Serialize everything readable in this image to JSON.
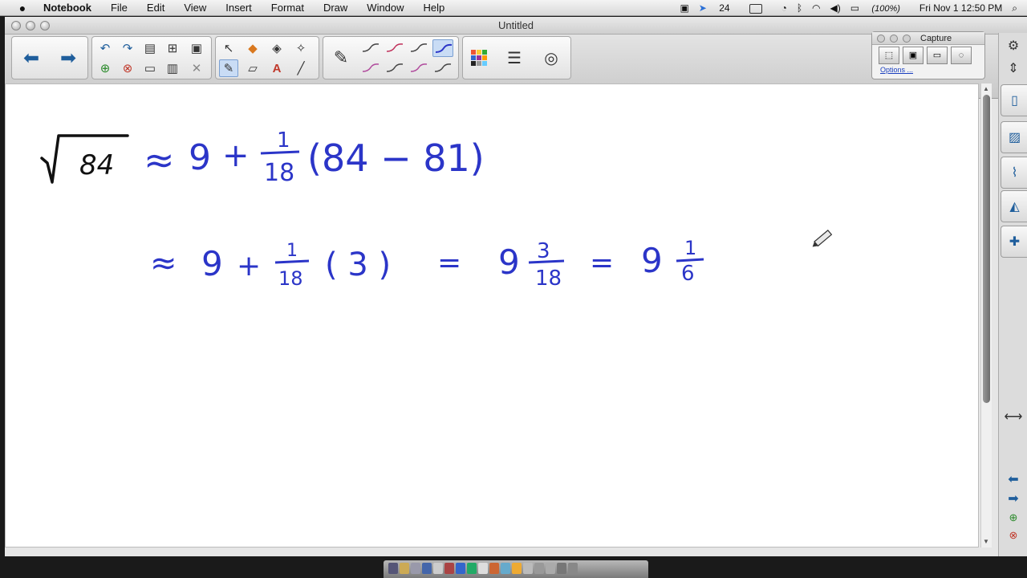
{
  "menubar": {
    "apple": "",
    "app_name": "Notebook",
    "menus": [
      "File",
      "Edit",
      "View",
      "Insert",
      "Format",
      "Draw",
      "Window",
      "Help"
    ],
    "status": {
      "count": "24",
      "battery": "(100%)",
      "datetime": "Fri Nov 1  12:50 PM"
    }
  },
  "window": {
    "title": "Untitled"
  },
  "capture": {
    "title": "Capture",
    "options_link": "Options ..."
  },
  "toolbar": {
    "icons": [
      "back-arrow",
      "forward-arrow",
      "undo",
      "redo",
      "screen-shade",
      "table",
      "delete",
      "select",
      "pens",
      "eraser",
      "text",
      "line",
      "magic-pen",
      "colors",
      "line-properties",
      "fill"
    ]
  },
  "math": {
    "line1": {
      "radicand": "84",
      "approx": "≈",
      "whole": "9",
      "plus": "+",
      "frac_num": "1",
      "frac_den": "18",
      "paren_expr": "(84 − 81)"
    },
    "line2": {
      "approx": "≈",
      "whole": "9",
      "plus": "+",
      "frac_num": "1",
      "frac_den": "18",
      "paren_expr": "( 3 )",
      "eq1": "=",
      "mixed_whole": "9",
      "mixed_num": "3",
      "mixed_den": "18",
      "eq2": "=",
      "result_whole": "9",
      "result_num": "1",
      "result_den": "6"
    }
  },
  "colors": {
    "ink_black": "#111111",
    "ink_blue": "#2b35c8",
    "accent": "#1f5e9c"
  }
}
